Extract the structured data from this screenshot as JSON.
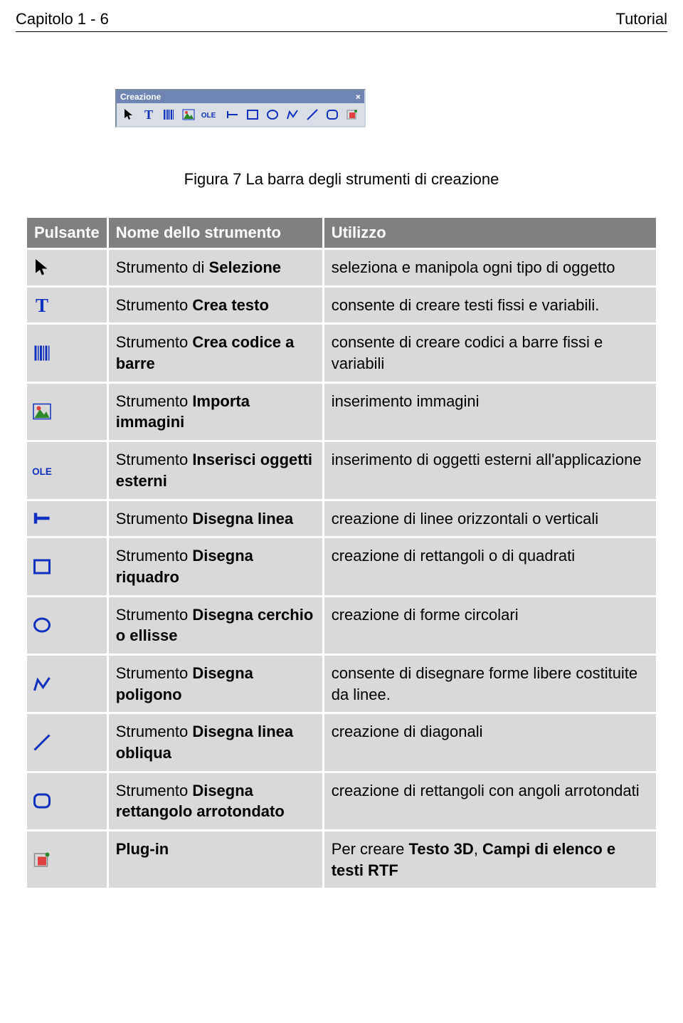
{
  "header": {
    "left": "Capitolo 1 - 6",
    "right": "Tutorial"
  },
  "toolbar_title": "Creazione",
  "caption": "Figura 7 La barra degli strumenti di creazione",
  "table": {
    "headers": [
      "Pulsante",
      "Nome dello strumento",
      "Utilizzo"
    ],
    "rows": [
      {
        "icon": "select",
        "name_plain": "Strumento di ",
        "name_bold": "Selezione",
        "usage": "seleziona e manipola ogni tipo di oggetto"
      },
      {
        "icon": "text",
        "name_plain": "Strumento ",
        "name_bold": "Crea testo",
        "usage": "consente di creare testi fissi e variabili."
      },
      {
        "icon": "barcode",
        "name_plain": "Strumento  ",
        "name_bold": "Crea codice a barre",
        "usage": "consente di creare codici a barre fissi e variabili"
      },
      {
        "icon": "image",
        "name_plain": "Strumento ",
        "name_bold": "Importa immagini",
        "usage": "inserimento immagini"
      },
      {
        "icon": "ole",
        "name_plain": "Strumento ",
        "name_bold": "Inserisci oggetti esterni",
        "usage": "inserimento di oggetti esterni all'applicazione"
      },
      {
        "icon": "hline",
        "name_plain": "Strumento  ",
        "name_bold": "Disegna linea",
        "usage": "creazione di linee orizzontali o verticali"
      },
      {
        "icon": "rect",
        "name_plain": "Strumento ",
        "name_bold": "Disegna riquadro",
        "usage": "creazione di rettangoli o di quadrati"
      },
      {
        "icon": "circle",
        "name_plain": "Strumento ",
        "name_bold": "Disegna cerchio o ellisse",
        "usage": "creazione di forme circolari"
      },
      {
        "icon": "polygon",
        "name_plain": "Strumento ",
        "name_bold": "Disegna poligono",
        "usage": "consente di disegnare forme libere costituite da linee."
      },
      {
        "icon": "diagonal",
        "name_plain": "Strumento ",
        "name_bold": "Disegna linea obliqua",
        "usage": "creazione di diagonali"
      },
      {
        "icon": "roundrect",
        "name_plain": "Strumento ",
        "name_bold": "Disegna rettangolo arrotondato",
        "usage": "creazione di rettangoli con angoli arrotondati"
      },
      {
        "icon": "plugin",
        "name_plain": "",
        "name_bold": "Plug-in",
        "usage_pre": "Per creare ",
        "usage_bold1": "Testo 3D",
        "usage_mid": ", ",
        "usage_bold2": "Campi di elenco e testi RTF"
      }
    ]
  }
}
